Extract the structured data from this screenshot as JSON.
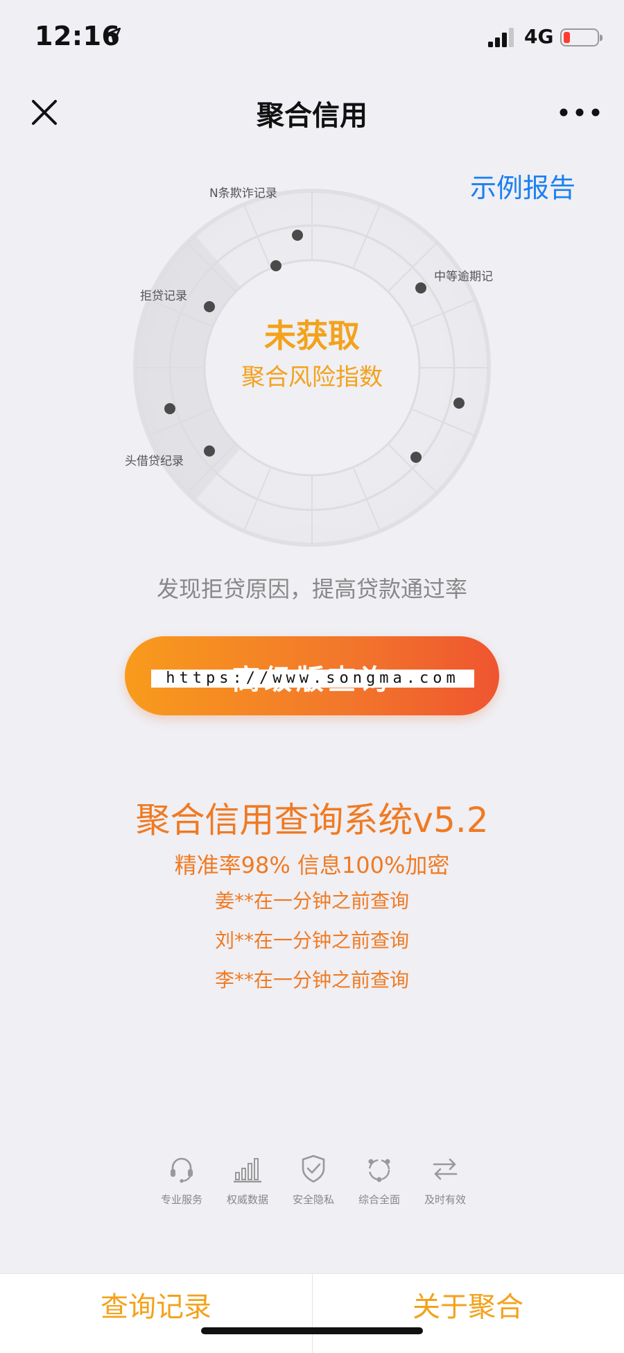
{
  "status": {
    "time": "12:16",
    "network": "4G"
  },
  "nav": {
    "title": "聚合信用"
  },
  "main": {
    "sample_report": "示例报告",
    "dial": {
      "status": "未获取",
      "subtitle": "聚合风险指数",
      "labels": [
        "N条欺诈记录",
        "中等逾期记",
        "拒贷记录",
        "头借贷纪录"
      ]
    },
    "hint": "发现拒贷原因，提高贷款通过率",
    "cta_label": "高级版查询",
    "watermark": "https://www.songma.com",
    "system_title": "聚合信用查询系统v5.2",
    "system_sub": "精准率98% 信息100%加密",
    "feed": [
      "姜**在一分钟之前查询",
      "刘**在一分钟之前查询",
      "李**在一分钟之前查询"
    ]
  },
  "features": [
    {
      "label": "专业服务",
      "icon": "headset-icon"
    },
    {
      "label": "权威数据",
      "icon": "bar-chart-icon"
    },
    {
      "label": "安全隐私",
      "icon": "shield-check-icon"
    },
    {
      "label": "综合全面",
      "icon": "share-circle-icon"
    },
    {
      "label": "及时有效",
      "icon": "swap-arrows-icon"
    }
  ],
  "tabs": {
    "left": "查询记录",
    "right": "关于聚合"
  },
  "colors": {
    "accent": "#f3a21c",
    "link": "#1a7ff0",
    "cta_start": "#f89b1c",
    "cta_end": "#ef5530",
    "text_orange": "#f07a22"
  }
}
